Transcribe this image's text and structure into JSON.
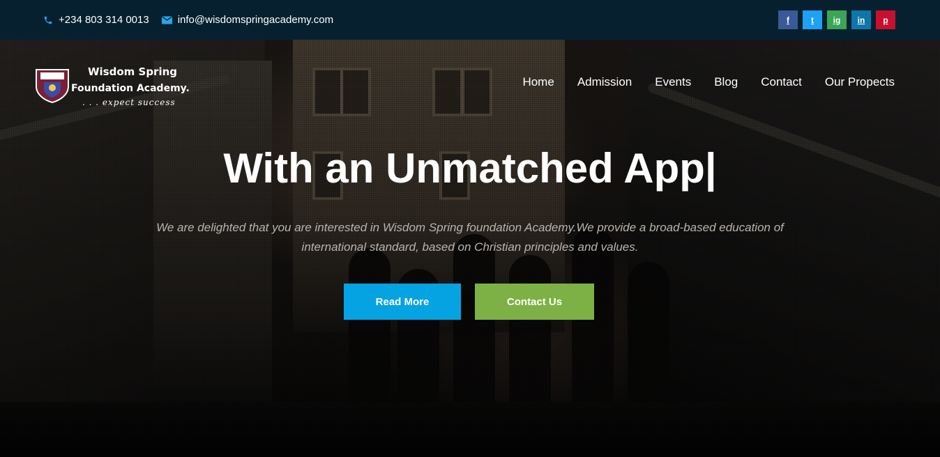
{
  "topbar": {
    "phone": "+234 803 314 0013",
    "email": "info@wisdomspringacademy.com",
    "phone_icon": "phone-icon",
    "email_icon": "envelope-icon",
    "socials": [
      {
        "name": "facebook",
        "glyph": "f",
        "color": "#3b5998"
      },
      {
        "name": "twitter",
        "glyph": "t",
        "color": "#1da1f2"
      },
      {
        "name": "instagram",
        "glyph": "ig",
        "color": "#3aa655"
      },
      {
        "name": "linkedin",
        "glyph": "in",
        "color": "#0e76a8"
      },
      {
        "name": "pinterest",
        "glyph": "p",
        "color": "#c8102e"
      }
    ]
  },
  "brand": {
    "line1": "Wisdom Spring",
    "line2": "Foundation Academy.",
    "tagline": ". . . expect success"
  },
  "nav": {
    "items": [
      "Home",
      "Admission",
      "Events",
      "Blog",
      "Contact",
      "Our Propects"
    ]
  },
  "hero": {
    "headline": "With an Unmatched App|",
    "subtext": "We are delighted that you are interested in Wisdom Spring foundation Academy.We provide a broad-based education of international standard, based on Christian principles and values.",
    "read_more": "Read More",
    "contact_us": "Contact Us"
  },
  "colors": {
    "topbar_bg": "#06202f",
    "read_more_bg": "#06a3e2",
    "contact_us_bg": "#7eb145"
  }
}
